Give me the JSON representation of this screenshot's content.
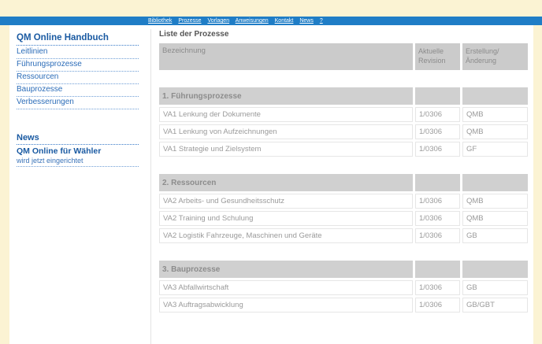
{
  "topnav": [
    "Bibliothek",
    "Prozesse",
    "Vorlagen",
    "Anweisungen",
    "Kontakt",
    "News",
    "?"
  ],
  "sidebar": {
    "title": "QM Online Handbuch",
    "items": [
      "Leitlinien",
      "Führungsprozesse",
      "Ressourcen",
      "Bauprozesse",
      "Verbesserungen"
    ]
  },
  "news": {
    "title": "News",
    "headline": "QM Online für Wähler",
    "sub": "wird jetzt eingerichtet"
  },
  "main": {
    "title": "Liste der Prozesse",
    "headers": [
      "Bezeichnung",
      "Aktuelle Revision",
      "Erstellung/ Änderung"
    ],
    "sections": [
      {
        "title": "1. Führungsprozesse",
        "rows": [
          [
            "VA1 Lenkung der Dokumente",
            "1/0306",
            "QMB"
          ],
          [
            "VA1 Lenkung von Aufzeichnungen",
            "1/0306",
            "QMB"
          ],
          [
            "VA1 Strategie und Zielsystem",
            "1/0306",
            "GF"
          ]
        ]
      },
      {
        "title": "2. Ressourcen",
        "rows": [
          [
            "VA2 Arbeits- und Gesundheitsschutz",
            "1/0306",
            "QMB"
          ],
          [
            "VA2 Training und Schulung",
            "1/0306",
            "QMB"
          ],
          [
            "VA2 Logistik Fahrzeuge, Maschinen und Geräte",
            "1/0306",
            "GB"
          ]
        ]
      },
      {
        "title": "3. Bauprozesse",
        "rows": [
          [
            "VA3 Abfallwirtschaft",
            "1/0306",
            "GB"
          ],
          [
            "VA3 Auftragsabwicklung",
            "1/0306",
            "GB/GBT"
          ]
        ]
      }
    ]
  }
}
